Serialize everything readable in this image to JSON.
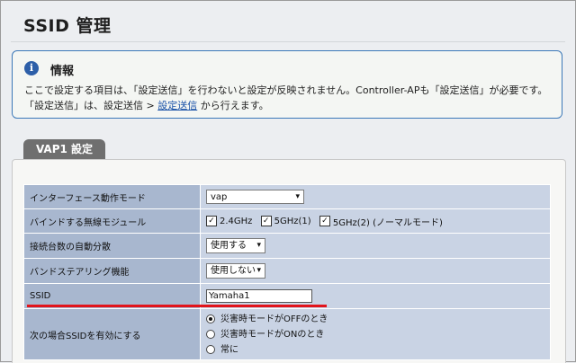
{
  "page": {
    "title": "SSID 管理"
  },
  "info": {
    "title": "情報",
    "line1": "ここで設定する項目は、「設定送信」を行わないと設定が反映されません。Controller-APも「設定送信」が必要です。",
    "line2_prefix": "「設定送信」は、設定送信 > ",
    "line2_link": "設定送信",
    "line2_suffix": " から行えます。"
  },
  "tab": {
    "label": "VAP1 設定"
  },
  "settings": {
    "interface_mode": {
      "label": "インターフェース動作モード",
      "value": "vap"
    },
    "radio_module": {
      "label": "バインドする無線モジュール",
      "options": [
        {
          "label": "2.4GHz",
          "checked": true
        },
        {
          "label": "5GHz(1)",
          "checked": true
        },
        {
          "label": "5GHz(2) (ノーマルモード)",
          "checked": true
        }
      ]
    },
    "auto_balance": {
      "label": "接続台数の自動分散",
      "value": "使用する"
    },
    "band_steering": {
      "label": "バンドステアリング機能",
      "value": "使用しない"
    },
    "ssid": {
      "label": "SSID",
      "value": "Yamaha1"
    },
    "enable_condition": {
      "label": "次の場合SSIDを有効にする",
      "options": [
        {
          "label": "災害時モードがOFFのとき",
          "selected": true
        },
        {
          "label": "災害時モードがONのとき",
          "selected": false
        },
        {
          "label": "常に",
          "selected": false
        }
      ]
    }
  },
  "colors": {
    "accent_red": "#e2141b",
    "label_cell": "#a8b7cf",
    "value_cell": "#c9d3e4",
    "info_border": "#3b78b8",
    "link": "#1a52a8"
  }
}
